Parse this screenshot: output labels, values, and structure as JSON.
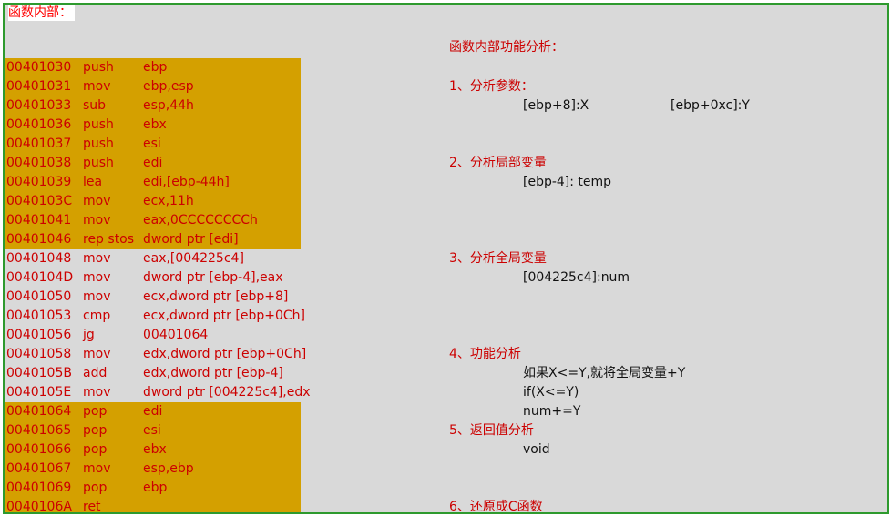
{
  "header_label": "函数内部：",
  "highlight_color": "#d4a000",
  "text_color": "#cc0000",
  "border_color": "#2e9a2e",
  "asm_lines": [
    {
      "addr": "00401030",
      "mnem": "push",
      "opnd": "ebp",
      "highlighted": true
    },
    {
      "addr": "00401031",
      "mnem": "mov",
      "opnd": "ebp,esp",
      "highlighted": true
    },
    {
      "addr": "00401033",
      "mnem": "sub",
      "opnd": "esp,44h",
      "highlighted": true
    },
    {
      "addr": "00401036",
      "mnem": "push",
      "opnd": "ebx",
      "highlighted": true
    },
    {
      "addr": "00401037",
      "mnem": "push",
      "opnd": "esi",
      "highlighted": true
    },
    {
      "addr": "00401038",
      "mnem": "push",
      "opnd": "edi",
      "highlighted": true
    },
    {
      "addr": "00401039",
      "mnem": "lea",
      "opnd": "edi,[ebp-44h]",
      "highlighted": true
    },
    {
      "addr": "0040103C",
      "mnem": "mov",
      "opnd": "ecx,11h",
      "highlighted": true
    },
    {
      "addr": "00401041",
      "mnem": "mov",
      "opnd": "eax,0CCCCCCCCh",
      "highlighted": true
    },
    {
      "addr": "00401046",
      "mnem": "rep stos",
      "opnd": "dword ptr [edi]",
      "highlighted": true
    },
    {
      "addr": "00401048",
      "mnem": "mov",
      "opnd": "eax,[004225c4]",
      "highlighted": false
    },
    {
      "addr": "0040104D",
      "mnem": "mov",
      "opnd": "dword ptr [ebp-4],eax",
      "highlighted": false
    },
    {
      "addr": "00401050",
      "mnem": "mov",
      "opnd": "ecx,dword ptr [ebp+8]",
      "highlighted": false
    },
    {
      "addr": "00401053",
      "mnem": "cmp",
      "opnd": "ecx,dword ptr [ebp+0Ch]",
      "highlighted": false
    },
    {
      "addr": "00401056",
      "mnem": "jg",
      "opnd": "00401064",
      "highlighted": false
    },
    {
      "addr": "00401058",
      "mnem": "mov",
      "opnd": "edx,dword ptr [ebp+0Ch]",
      "highlighted": false
    },
    {
      "addr": "0040105B",
      "mnem": "add",
      "opnd": "edx,dword ptr [ebp-4]",
      "highlighted": false
    },
    {
      "addr": "0040105E",
      "mnem": "mov",
      "opnd": "dword ptr [004225c4],edx",
      "highlighted": false
    },
    {
      "addr": "00401064",
      "mnem": "pop",
      "opnd": "edi",
      "highlighted": true
    },
    {
      "addr": "00401065",
      "mnem": "pop",
      "opnd": "esi",
      "highlighted": true
    },
    {
      "addr": "00401066",
      "mnem": "pop",
      "opnd": "ebx",
      "highlighted": true
    },
    {
      "addr": "00401067",
      "mnem": "mov",
      "opnd": "esp,ebp",
      "highlighted": true
    },
    {
      "addr": "00401069",
      "mnem": "pop",
      "opnd": "ebp",
      "highlighted": true
    },
    {
      "addr": "0040106A",
      "mnem": "ret",
      "opnd": "",
      "highlighted": true
    }
  ],
  "analysis": {
    "title": "函数内部功能分析：",
    "sec1_heading": "1、分析参数：",
    "sec1_param_x": "[ebp+8]:X",
    "sec1_param_y": "[ebp+0xc]:Y",
    "sec2_heading": "2、分析局部变量",
    "sec2_line": "[ebp-4]: temp",
    "sec3_heading": "3、分析全局变量",
    "sec3_line": "[004225c4]:num",
    "sec4_heading": "4、功能分析",
    "sec4_line1": "如果X<=Y,就将全局变量+Y",
    "sec4_line2": "if(X<=Y)",
    "sec4_line3": "num+=Y",
    "sec5_heading": "5、返回值分析",
    "sec5_line": "void",
    "sec6_heading": "6、还原成C函数"
  }
}
